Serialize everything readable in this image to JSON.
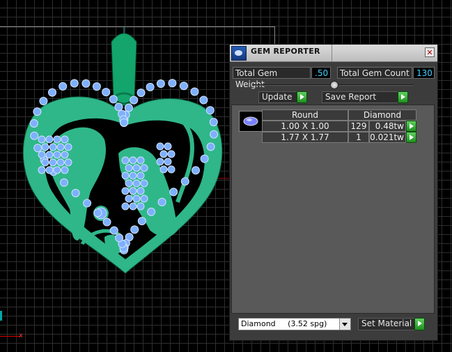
{
  "viewport": {
    "axis_x_label": "x"
  },
  "panel": {
    "title": "GEM REPORTER",
    "close_label": "✕",
    "total_weight_label": "Total Gem Weight",
    "total_weight_value": ".50",
    "total_count_label": "Total Gem Count",
    "total_count_value": "130",
    "update_label": "Update",
    "save_report_label": "Save Report",
    "table": {
      "shape_header": "Round",
      "material_header": "Diamond",
      "rows": [
        {
          "size": "1.00 X 1.00",
          "count": "129",
          "weight": "0.48tw"
        },
        {
          "size": "1.77 X 1.77",
          "count": "1",
          "weight": "0.021tw"
        }
      ]
    },
    "material_select": "Diamond     (3.52 spg)",
    "set_material_label": "Set Material"
  }
}
